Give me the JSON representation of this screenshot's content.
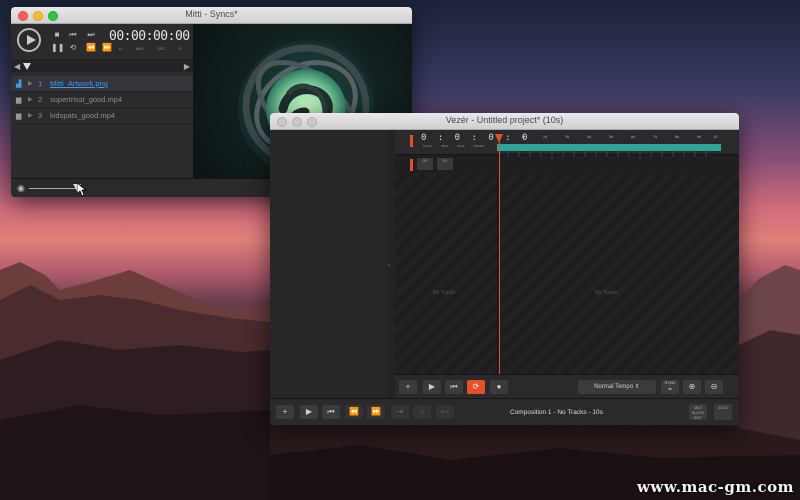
{
  "mitti": {
    "title": "Mitti - Syncs*",
    "timecode": "00:00:00:00",
    "timecode_units": [
      "H",
      "MIN",
      "SEC",
      "F"
    ],
    "cues": [
      {
        "number": "1",
        "name": "Mitti_Artwork.png",
        "icon": "image-icon",
        "selected": true
      },
      {
        "number": "2",
        "name": "supertrisst_good.mp4",
        "icon": "film-icon",
        "selected": false
      },
      {
        "number": "3",
        "name": "kidspats_good.mp4",
        "icon": "film-icon",
        "selected": false
      }
    ],
    "accent": "#3a9df0"
  },
  "vezer": {
    "title": "Vezér - Untitled project* (10s)",
    "timecode": "0 : 0 : 0 : 0",
    "timecode_units": [
      "hours",
      "mins",
      "secs",
      "frames"
    ],
    "ruler_marks": [
      "0",
      "1s",
      "2s",
      "3s",
      "4s",
      "5s",
      "6s",
      "7s",
      "8s",
      "9s",
      "10"
    ],
    "mini_buttons": [
      "OK",
      "OK"
    ],
    "no_tracks_left": "No Tracks",
    "no_tracks_right": "No Tracks",
    "tempo": "Normal Tempo",
    "sync_label": "SYNC",
    "status": "Composition 1 - No Tracks - 10s",
    "bar2_small_left": "MIDI BLOCK EDIT",
    "bar2_small_right": "AUTO",
    "skip_label": "SKIP",
    "accent": "#e4502a",
    "strip_color": "#2ea39a"
  },
  "watermark": "www.mac-gm.com"
}
